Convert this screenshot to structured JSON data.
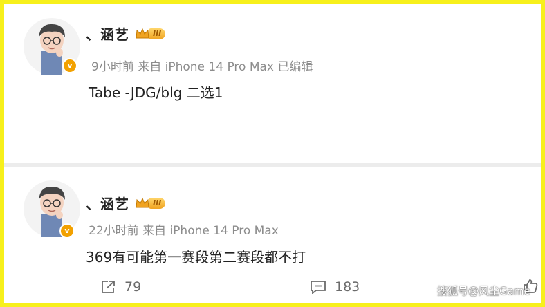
{
  "posts": [
    {
      "username": "、涵艺",
      "level_badge": "III",
      "verified_badge": "v",
      "meta": "9小时前 来自 iPhone 14 Pro Max 已编辑",
      "content": "Tabe -JDG/blg 二选1"
    },
    {
      "username": "、涵艺",
      "level_badge": "III",
      "verified_badge": "v",
      "meta": "22小时前 来自 iPhone 14 Pro Max",
      "content": "369有可能第一赛段第二赛段都不打",
      "actions": {
        "repost_count": "79",
        "comment_count": "183"
      }
    }
  ],
  "watermark": "搜狐号@风尘Game",
  "colors": {
    "frame": "#f7f01c",
    "verified": "#f2a100",
    "meta_text": "#8c8c8c"
  },
  "icons": [
    "avatar",
    "crown-icon",
    "verified-icon",
    "repost-icon",
    "comment-icon",
    "like-icon"
  ]
}
